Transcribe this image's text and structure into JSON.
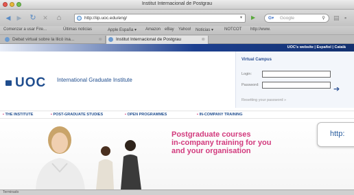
{
  "window": {
    "title": "Institut Internacional de Postgrau"
  },
  "toolbar": {
    "url": "http://iip.uoc.edu/eng/",
    "search_placeholder": "Google"
  },
  "bookmarks": [
    "Comenzar a usar Fire...",
    "Últimas noticias",
    "Apple España ▾",
    "Amazon",
    "eBay",
    "Yahoo!",
    "Noticias ▾",
    "NOTCOT",
    "http://www."
  ],
  "tabs": [
    {
      "label": "Debat virtual sobre la llicò ina..."
    },
    {
      "label": "Institut Internacional de Postgrau"
    }
  ],
  "page": {
    "site_links": "UOC's website | Español | Català",
    "logo_word": "UOC",
    "logo_text": "International Graduate Institute",
    "virtual_campus": {
      "title": "Virtual Campus",
      "login_label": "Login:",
      "password_label": "Password:",
      "forgot": "Resetting your password »"
    },
    "menu": [
      "THE INSTITUTE",
      "POST-GRADUATE STUDIES",
      "OPEN PROGRAMMES",
      "IN-COMPANY TRAINING"
    ],
    "headline": [
      "Postgraduate courses",
      "in-company training for you",
      "and your organisation"
    ],
    "tooltip": "http:"
  },
  "status": {
    "text": "Terminado"
  },
  "colors": {
    "brand_blue": "#1f4d8e",
    "accent_pink": "#d23a7d"
  }
}
